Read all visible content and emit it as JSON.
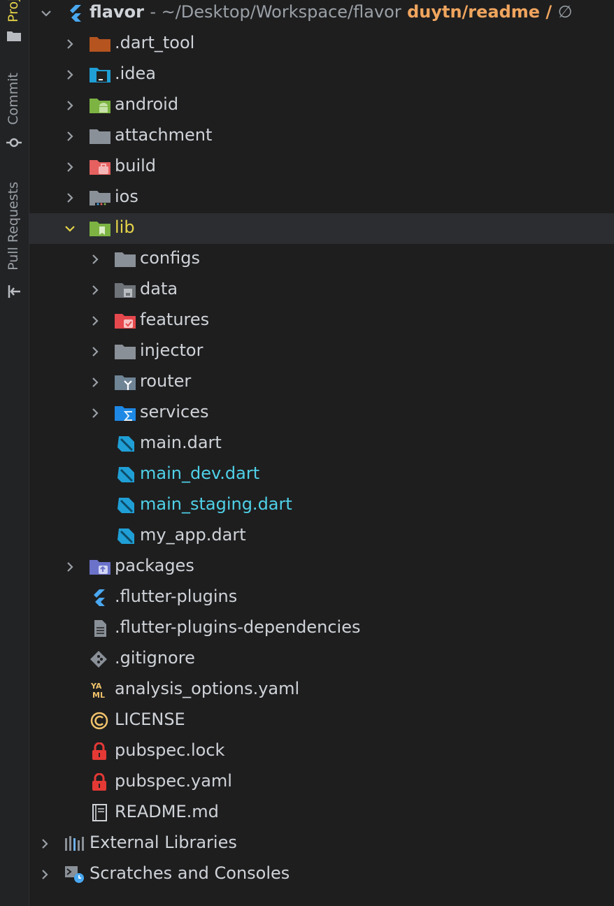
{
  "side_tabs": {
    "project": "Project",
    "commit": "Commit",
    "pull_requests": "Pull Requests"
  },
  "header": {
    "name": "flavor",
    "path": "- ~/Desktop/Workspace/flavor",
    "branch": "duytn/readme /",
    "branch_extra": "∅"
  },
  "items": [
    {
      "label": ".dart_tool"
    },
    {
      "label": ".idea"
    },
    {
      "label": "android"
    },
    {
      "label": "attachment"
    },
    {
      "label": "build"
    },
    {
      "label": "ios"
    },
    {
      "label": "lib"
    },
    {
      "label": "configs"
    },
    {
      "label": "data"
    },
    {
      "label": "features"
    },
    {
      "label": "injector"
    },
    {
      "label": "router"
    },
    {
      "label": "services"
    },
    {
      "label": "main.dart"
    },
    {
      "label": "main_dev.dart"
    },
    {
      "label": "main_staging.dart"
    },
    {
      "label": "my_app.dart"
    },
    {
      "label": "packages"
    },
    {
      "label": ".flutter-plugins"
    },
    {
      "label": ".flutter-plugins-dependencies"
    },
    {
      "label": ".gitignore"
    },
    {
      "label": "analysis_options.yaml"
    },
    {
      "label": "LICENSE"
    },
    {
      "label": "pubspec.lock"
    },
    {
      "label": "pubspec.yaml"
    },
    {
      "label": "README.md"
    },
    {
      "label": "External Libraries"
    },
    {
      "label": "Scratches and Consoles"
    }
  ],
  "colors": {
    "selected_row": "#2b2d30",
    "modified_file": "#4fd1e8",
    "folder": "#8a9097",
    "branch": "#f0a55e",
    "lib_label": "#e6d44a"
  }
}
